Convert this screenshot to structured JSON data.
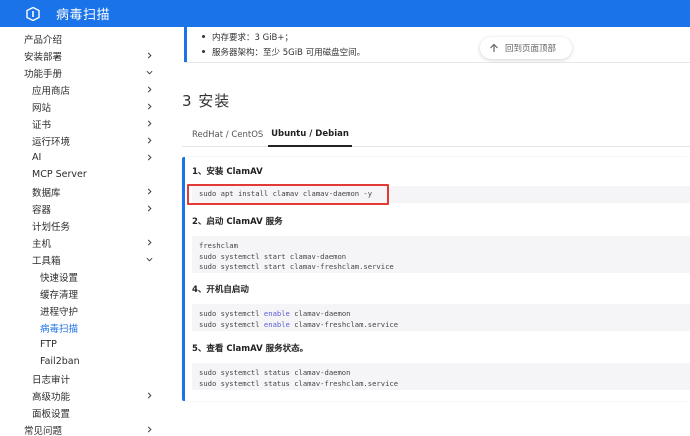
{
  "header": {
    "title": "病毒扫描",
    "logo_icon": "shield-logo-icon",
    "accent": "#1a73e8"
  },
  "sidebar": {
    "items": [
      {
        "label": "产品介绍",
        "chevron": ""
      },
      {
        "label": "安装部署",
        "chevron": "right"
      },
      {
        "label": "功能手册",
        "chevron": "down"
      },
      {
        "label": "应用商店",
        "chevron": "right"
      },
      {
        "label": "网站",
        "chevron": "right"
      },
      {
        "label": "证书",
        "chevron": "right"
      },
      {
        "label": "运行环境",
        "chevron": "right"
      },
      {
        "label": "AI",
        "chevron": "right"
      },
      {
        "label": "MCP Server",
        "chevron": ""
      },
      {
        "label": "数据库",
        "chevron": "right"
      },
      {
        "label": "容器",
        "chevron": "right"
      },
      {
        "label": "计划任务",
        "chevron": ""
      },
      {
        "label": "主机",
        "chevron": "right"
      },
      {
        "label": "工具箱",
        "chevron": "down"
      },
      {
        "label": "快速设置",
        "chevron": ""
      },
      {
        "label": "缓存清理",
        "chevron": ""
      },
      {
        "label": "进程守护",
        "chevron": ""
      },
      {
        "label": "病毒扫描",
        "chevron": "",
        "active": true
      },
      {
        "label": "FTP",
        "chevron": ""
      },
      {
        "label": "Fail2ban",
        "chevron": ""
      },
      {
        "label": "日志审计",
        "chevron": ""
      },
      {
        "label": "高级功能",
        "chevron": "right"
      },
      {
        "label": "面板设置",
        "chevron": ""
      },
      {
        "label": "常见问题",
        "chevron": "right"
      }
    ]
  },
  "requirements": [
    "内存要求：3 GiB+；",
    "服务器架构：至少 5GiB 可用磁盘空间。"
  ],
  "back_to_top": "回到页面顶部",
  "section_title": "3 安装",
  "tabs": [
    {
      "label": "RedHat / CentOS",
      "active": false
    },
    {
      "label": "Ubuntu / Debian",
      "active": true
    }
  ],
  "steps": [
    {
      "title": "1、安装 ClamAV",
      "code": [
        "sudo apt install clamav clamav-daemon -y"
      ],
      "highlighted": true
    },
    {
      "title": "2、启动 ClamAV 服务",
      "code": [
        "freshclam",
        "sudo systemctl start clamav-daemon",
        "sudo systemctl start clamav-freshclam.service"
      ]
    },
    {
      "title": "4、开机自启动",
      "code": [
        "sudo systemctl {kw}enable{/kw} clamav-daemon",
        "sudo systemctl {kw}enable{/kw} clamav-freshclam.service"
      ]
    },
    {
      "title": "5、查看 ClamAV 服务状态。",
      "code": [
        "sudo systemctl status clamav-daemon",
        "sudo systemctl status clamav-freshclam.service"
      ]
    }
  ],
  "colors": {
    "highlight_border": "#e53935",
    "keyword": "#5c5cd6"
  }
}
